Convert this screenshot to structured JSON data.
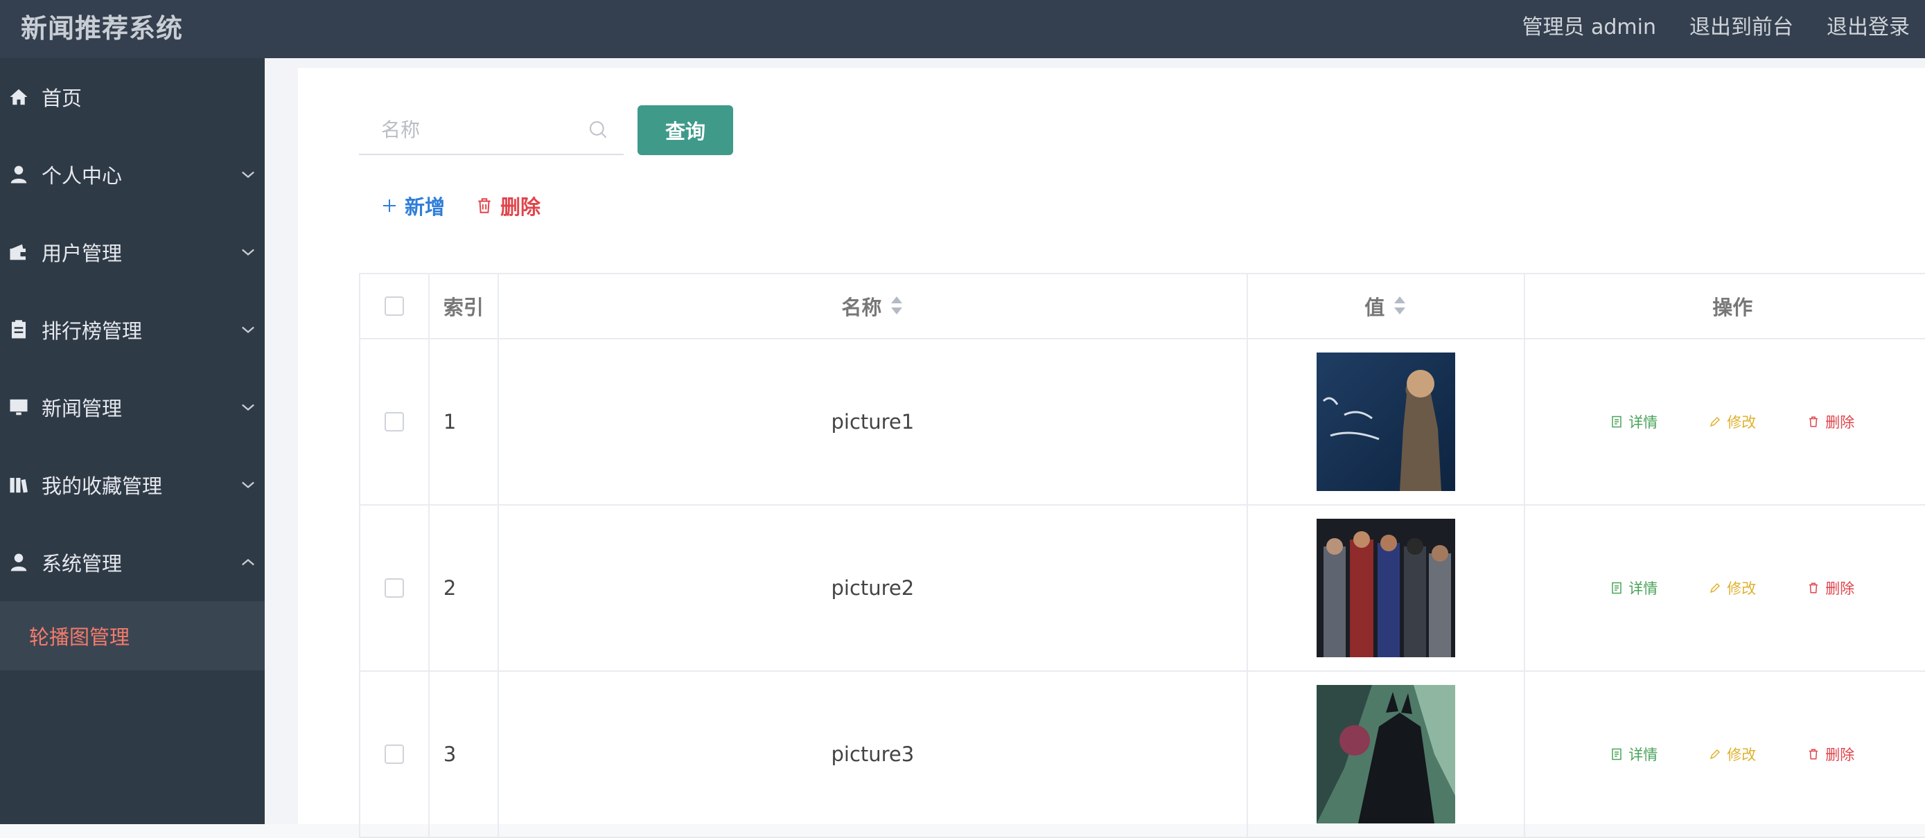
{
  "app": {
    "title": "新闻推荐系统",
    "user_label": "管理员 admin",
    "to_front": "退出到前台",
    "logout": "退出登录"
  },
  "sidebar": {
    "items": [
      {
        "label": "首页",
        "icon": "home-icon",
        "expandable": false
      },
      {
        "label": "个人中心",
        "icon": "user-icon",
        "expandable": true
      },
      {
        "label": "用户管理",
        "icon": "wallet-icon",
        "expandable": true
      },
      {
        "label": "排行榜管理",
        "icon": "clipboard-icon",
        "expandable": true
      },
      {
        "label": "新闻管理",
        "icon": "monitor-icon",
        "expandable": true
      },
      {
        "label": "我的收藏管理",
        "icon": "books-icon",
        "expandable": true
      },
      {
        "label": "系统管理",
        "icon": "user-icon",
        "expandable": true,
        "expanded": true
      }
    ],
    "submenu_active": "轮播图管理"
  },
  "search": {
    "placeholder": "名称",
    "query_button": "查询"
  },
  "actions": {
    "add": "新增",
    "delete": "删除"
  },
  "table": {
    "columns": {
      "index": "索引",
      "name": "名称",
      "value": "值",
      "ops": "操作"
    },
    "rows": [
      {
        "index": "1",
        "name": "picture1"
      },
      {
        "index": "2",
        "name": "picture2"
      },
      {
        "index": "3",
        "name": "picture3"
      }
    ],
    "ops": {
      "detail": "详情",
      "edit": "修改",
      "delete": "删除"
    }
  },
  "colors": {
    "header_bg": "#34404f",
    "sidebar_bg": "#2f3a47",
    "accent_teal": "#3f9a8a",
    "active_submenu": "#f47b6b",
    "link_blue": "#2f7ed8",
    "danger_red": "#e0444b",
    "detail_green": "#4aa35a",
    "edit_yellow": "#e0b12e"
  }
}
